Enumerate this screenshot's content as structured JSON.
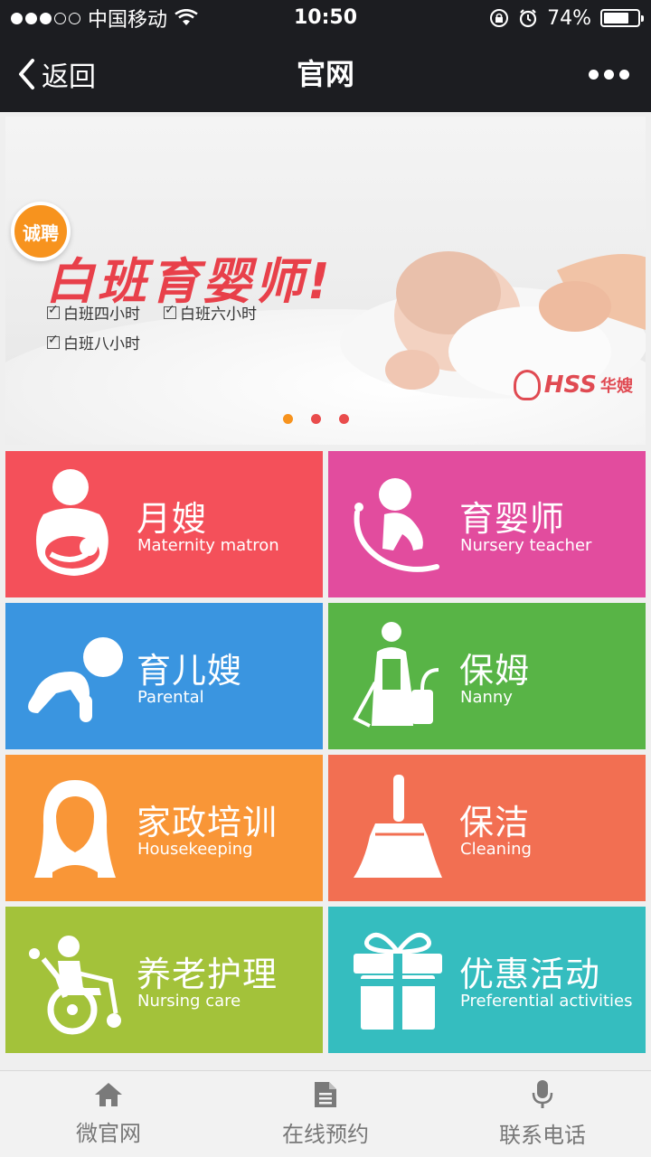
{
  "status_bar": {
    "carrier": "中国移动",
    "time": "10:50",
    "battery_percent_text": "74%",
    "battery_level": 0.74
  },
  "nav": {
    "back_label": "返回",
    "title": "官网"
  },
  "banner": {
    "badge": "诚聘",
    "headline": "白班育婴师!",
    "options": [
      "白班四小时",
      "白班六小时",
      "白班八小时"
    ],
    "logo_text": "HSS",
    "logo_cn": "华嫂",
    "slides_total": 3,
    "active_slide": 1
  },
  "services": [
    {
      "cn": "月嫂",
      "en": "Maternity matron",
      "color": "#f4505a",
      "icon": "mother-baby-icon"
    },
    {
      "cn": "育婴师",
      "en": "Nursery teacher",
      "color": "#e24c9e",
      "icon": "baby-cradle-icon"
    },
    {
      "cn": "育儿嫂",
      "en": "Parental",
      "color": "#3a95e0",
      "icon": "crawling-baby-icon"
    },
    {
      "cn": "保姆",
      "en": "Nanny",
      "color": "#58b446",
      "icon": "housekeeper-vacuum-icon"
    },
    {
      "cn": "家政培训",
      "en": "Housekeeping",
      "color": "#f99637",
      "icon": "woman-portrait-icon"
    },
    {
      "cn": "保洁",
      "en": "Cleaning",
      "color": "#f26f52",
      "icon": "broom-icon"
    },
    {
      "cn": "养老护理",
      "en": "Nursing care",
      "color": "#a3c23a",
      "icon": "wheelchair-icon"
    },
    {
      "cn": "优惠活动",
      "en": "Preferential activities",
      "color": "#35bdbf",
      "icon": "gift-icon"
    }
  ],
  "tabbar": [
    {
      "label": "微官网",
      "icon": "home-icon"
    },
    {
      "label": "在线预约",
      "icon": "document-icon"
    },
    {
      "label": "联系电话",
      "icon": "microphone-icon"
    }
  ]
}
